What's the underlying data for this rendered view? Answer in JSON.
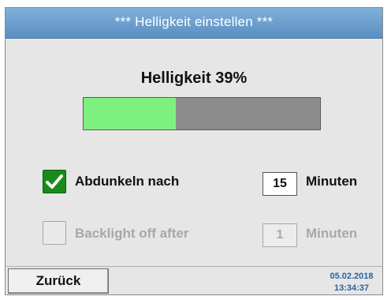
{
  "title": "***  Helligkeit einstellen  ***",
  "brightness": {
    "label": "Helligkeit 39%",
    "level_percent": 39,
    "fill_color": "#7ef07e",
    "track_color": "#8c8c8c"
  },
  "options": [
    {
      "checked": true,
      "checkbox_icon": "check-icon",
      "label": "Abdunkeln nach",
      "value": "15",
      "unit": "Minuten",
      "enabled": true
    },
    {
      "checked": false,
      "label": "Backlight off after",
      "value": "1",
      "unit": "Minuten",
      "enabled": false
    }
  ],
  "footer": {
    "back_label": "Zurück",
    "date": "05.02.2018",
    "time": "13:34:37"
  },
  "colors": {
    "title_bar": "#6a9fd0",
    "checkbox_checked": "#1a8a1a",
    "datetime_text": "#2a62a6"
  }
}
